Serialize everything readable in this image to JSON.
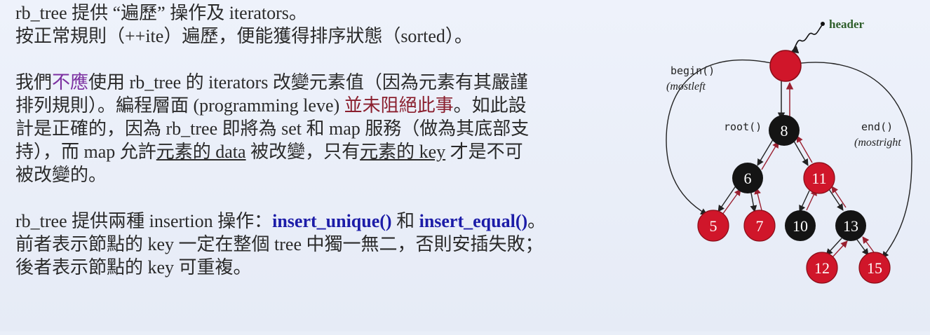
{
  "paragraph1": {
    "line1": "rb_tree 提供 “遍歷” 操作及 iterators。",
    "line2": "按正常規則（++ite）遍歷，便能獲得排序狀態（sorted）。"
  },
  "paragraph2": {
    "line1_a": "我們",
    "line1_b": "不應",
    "line1_c": "使用 rb_tree 的 iterators 改變元素值（因為元素有其嚴謹",
    "line2_a": "排列規則）。編程層面 (programming leve) ",
    "line2_b": "並未阻絕此事",
    "line2_c": "。如此設",
    "line3": "計是正確的，因為 rb_tree 即將為 set 和 map 服務（做為其底部支",
    "line4_a": "持），而 map 允許",
    "line4_b": "元素的 data",
    "line4_c": " 被改變，只有",
    "line4_d": "元素的 key",
    "line4_e": " 才是不可",
    "line5": "被改變的。"
  },
  "paragraph3": {
    "line1_a": "rb_tree 提供兩種 insertion 操作：",
    "line1_b": "insert_unique()",
    "line1_c": " 和 ",
    "line1_d": "insert_equal()",
    "line1_e": "。",
    "line2": "前者表示節點的 key 一定在整個 tree 中獨一無二，否則安插失敗；",
    "line3": "後者表示節點的 key 可重複。"
  },
  "diagram": {
    "header_label": "header",
    "begin_label": "begin()",
    "begin_sub": "(mostleft",
    "root_label": "root()",
    "end_label": "end()",
    "end_sub": "(mostright",
    "nodes": {
      "n8": "8",
      "n6": "6",
      "n11": "11",
      "n5": "5",
      "n7": "7",
      "n10": "10",
      "n13": "13",
      "n12": "12",
      "n15": "15"
    },
    "colors": {
      "red": "#d0162a",
      "black": "#141414",
      "header_label": "#2e5e2a",
      "link": "#9a2030"
    }
  }
}
